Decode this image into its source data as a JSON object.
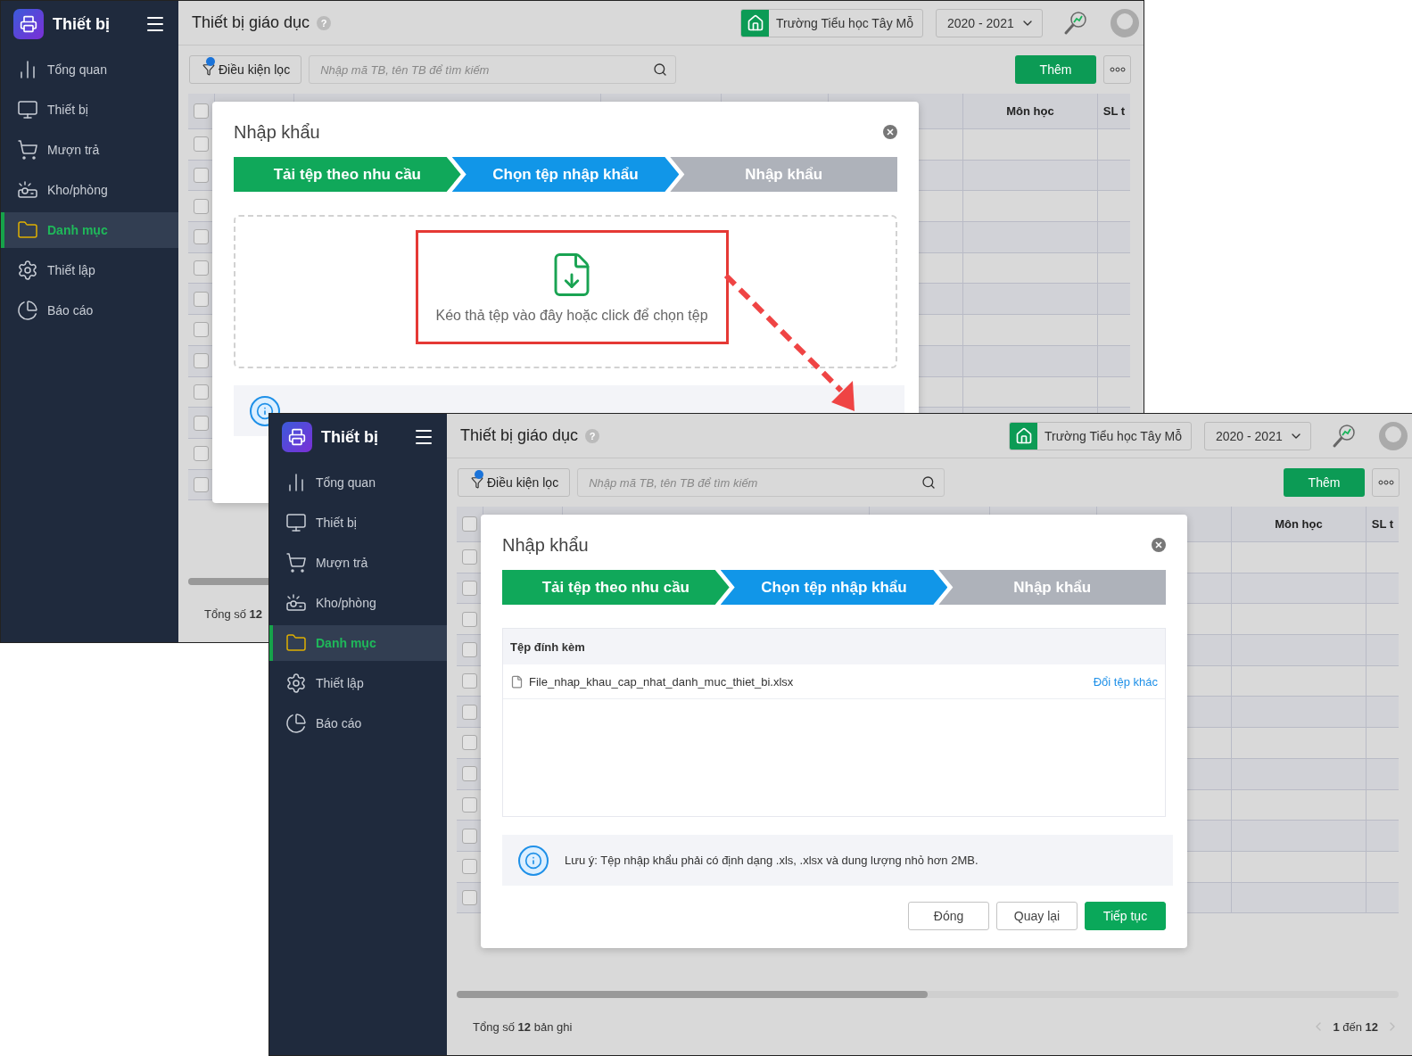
{
  "windows": [
    {
      "kind": "upload",
      "app_title": "Thiết bị",
      "sidebar": {
        "items": [
          {
            "label": "Tổng quan",
            "selected": false
          },
          {
            "label": "Thiết bị",
            "selected": false
          },
          {
            "label": "Mượn trả",
            "selected": false
          },
          {
            "label": "Kho/phòng",
            "selected": false
          },
          {
            "label": "Danh mục",
            "selected": true
          },
          {
            "label": "Thiết lập",
            "selected": false
          },
          {
            "label": "Báo cáo",
            "selected": false
          }
        ]
      },
      "header": {
        "title": "Thiết bị giáo dục",
        "help": "?",
        "school": "Trường Tiểu học Tây Mỗ",
        "year": "2020 - 2021"
      },
      "toolbar": {
        "filter_label": "Điều kiện lọc",
        "search_placeholder": "Nhập mã TB, tên TB để tìm kiếm",
        "add_button": "Thêm"
      },
      "table": {
        "all_checked": false,
        "columns": [
          {
            "label": "Môn học"
          },
          {
            "label": "SL t"
          }
        ],
        "rows": [
          {
            "checked": false
          },
          {
            "checked": false
          },
          {
            "checked": false
          },
          {
            "checked": false
          },
          {
            "checked": false
          },
          {
            "checked": false
          },
          {
            "checked": false
          },
          {
            "checked": false
          },
          {
            "checked": false
          },
          {
            "checked": false
          },
          {
            "checked": false
          },
          {
            "checked": false
          }
        ]
      },
      "dialog": {
        "title": "Nhập khẩu",
        "steps": [
          {
            "label": "Tải tệp theo nhu cầu",
            "selected": false
          },
          {
            "label": "Chọn tệp nhập khẩu",
            "selected": true
          },
          {
            "label": "Nhập khẩu",
            "selected": false
          }
        ],
        "dropzone": {
          "text": "Kéo thả tệp vào đây hoặc click để chọn tệp"
        }
      },
      "footer": {
        "total": "Tổng số **12**"
      }
    },
    {
      "kind": "file_list",
      "app_title": "Thiết bị",
      "sidebar": {
        "items": [
          {
            "label": "Tổng quan",
            "selected": false
          },
          {
            "label": "Thiết bị",
            "selected": false
          },
          {
            "label": "Mượn trả",
            "selected": false
          },
          {
            "label": "Kho/phòng",
            "selected": false
          },
          {
            "label": "Danh mục",
            "selected": true
          },
          {
            "label": "Thiết lập",
            "selected": false
          },
          {
            "label": "Báo cáo",
            "selected": false
          }
        ]
      },
      "header": {
        "title": "Thiết bị giáo dục",
        "help": "?",
        "school": "Trường Tiểu học Tây Mỗ",
        "year": "2020 - 2021"
      },
      "toolbar": {
        "filter_label": "Điều kiện lọc",
        "search_placeholder": "Nhập mã TB, tên TB để tìm kiếm",
        "add_button": "Thêm"
      },
      "table": {
        "all_checked": false,
        "columns": [
          {
            "label": "Môn học"
          },
          {
            "label": "SL t"
          }
        ],
        "rows": [
          {
            "checked": false
          },
          {
            "checked": false
          },
          {
            "checked": false
          },
          {
            "checked": false
          },
          {
            "checked": false
          },
          {
            "checked": false
          },
          {
            "checked": false
          },
          {
            "checked": false
          },
          {
            "checked": false
          },
          {
            "checked": false
          },
          {
            "checked": false
          },
          {
            "checked": false
          }
        ]
      },
      "dialog": {
        "title": "Nhập khẩu",
        "steps": [
          {
            "label": "Tải tệp theo nhu cầu",
            "selected": false
          },
          {
            "label": "Chọn tệp nhập khẩu",
            "selected": true
          },
          {
            "label": "Nhập khẩu",
            "selected": false
          }
        ],
        "attachment": {
          "header": "Tệp đính kèm",
          "file_name": "File_nhap_khau_cap_nhat_danh_muc_thiet_bi.xlsx",
          "change_link": "Đổi tệp khác"
        },
        "note": "Lưu ý: Tệp nhập khẩu phải có định dạng .xls, .xlsx và dung lượng nhỏ hơn 2MB.",
        "buttons": [
          {
            "label": "Đóng",
            "kind": "secondary"
          },
          {
            "label": "Quay lại",
            "kind": "secondary"
          },
          {
            "label": "Tiếp tục",
            "kind": "primary"
          }
        ]
      },
      "footer": {
        "total": "Tổng số **12** bản ghi",
        "pager": "**1** đến **12**"
      }
    }
  ]
}
